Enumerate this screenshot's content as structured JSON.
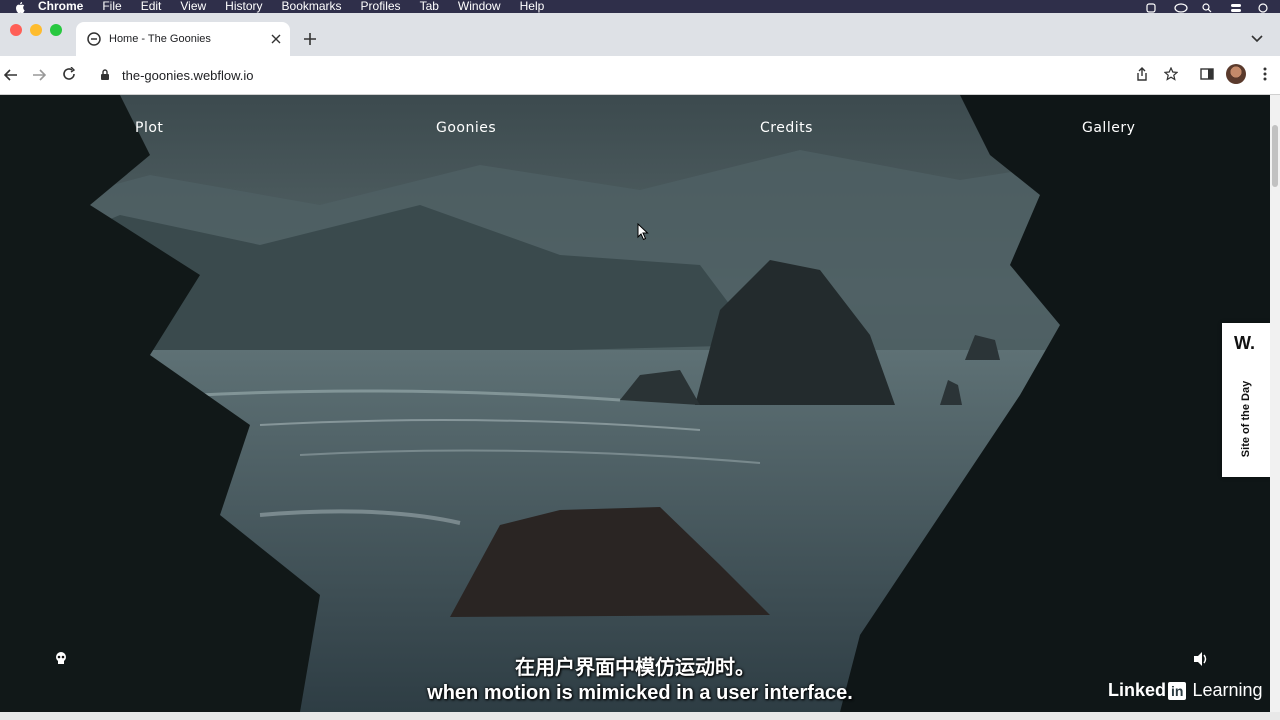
{
  "menubar": {
    "app": "Chrome",
    "items": [
      "File",
      "Edit",
      "View",
      "History",
      "Bookmarks",
      "Profiles",
      "Tab",
      "Window",
      "Help"
    ]
  },
  "tab": {
    "title": "Home - The Goonies"
  },
  "toolbar": {
    "url": "the-goonies.webflow.io"
  },
  "page": {
    "nav": [
      "Plot",
      "Goonies",
      "Credits",
      "Gallery"
    ],
    "badge": {
      "logo": "W.",
      "label": "Site of the Day"
    }
  },
  "subtitles": {
    "chinese": "在用户界面中模仿运动时。",
    "english": "when motion is mimicked in a user interface."
  },
  "watermark": {
    "brand": "Linked",
    "in": "in",
    "suffix": "Learning"
  },
  "colors": {
    "menubar": "#2f2f4a",
    "tabbar": "#dee1e6",
    "toolbar": "#ffffff"
  }
}
